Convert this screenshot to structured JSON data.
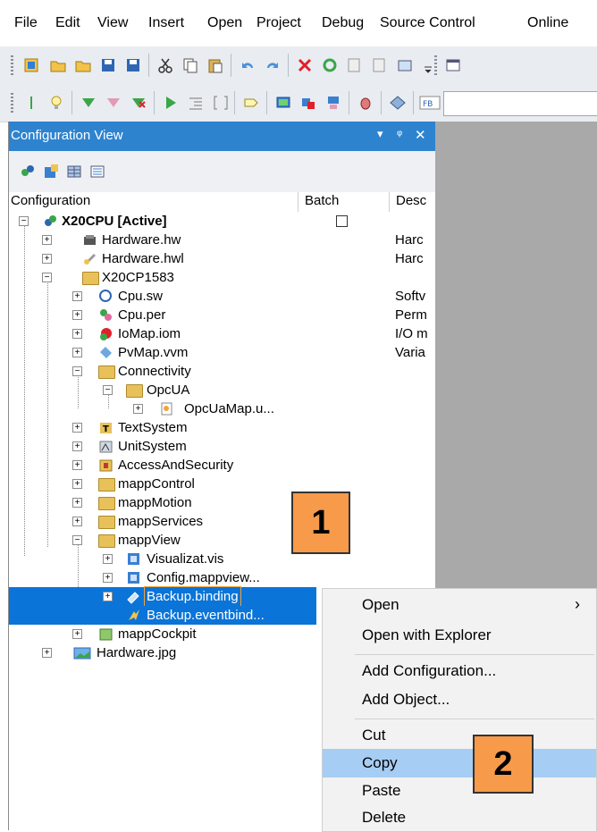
{
  "menu": [
    "File",
    "Edit",
    "View",
    "Insert",
    "Open",
    "Project",
    "Debug",
    "Source Control",
    "Online"
  ],
  "panel": {
    "title": "Configuration View",
    "title_icons": [
      "▾",
      "ᵠ",
      "✕"
    ],
    "columns": {
      "configuration": "Configuration",
      "batch": "Batch",
      "description": "Desc"
    }
  },
  "tree": {
    "root": "X20CPU [Active]",
    "hw": "Hardware.hw",
    "hw_desc": "Harc",
    "hwl": "Hardware.hwl",
    "hwl_desc": "Harc",
    "cpu_folder": "X20CP1583",
    "cpusw": "Cpu.sw",
    "cpusw_desc": "Softv",
    "cpuper": "Cpu.per",
    "cpuper_desc": "Perm",
    "iomap": "IoMap.iom",
    "iomap_desc": "I/O m",
    "pvmap": "PvMap.vvm",
    "pvmap_desc": "Varia",
    "connectivity": "Connectivity",
    "opcua": "OpcUA",
    "opcuamap": "OpcUaMap.u...",
    "textsystem": "TextSystem",
    "unitsystem": "UnitSystem",
    "access": "AccessAndSecurity",
    "mappcontrol": "mappControl",
    "mappmotion": "mappMotion",
    "mappservices": "mappServices",
    "mappview": "mappView",
    "vis": "Visualizat.vis",
    "configmv": "Config.mappview...",
    "binding": "Backup.binding",
    "eventbind": "Backup.eventbind...",
    "mappcockpit": "mappCockpit",
    "hwjpg": "Hardware.jpg"
  },
  "context_menu": {
    "open": "Open",
    "open_arrow": "›",
    "open_explorer": "Open with Explorer",
    "add_config": "Add Configuration...",
    "add_object": "Add Object...",
    "cut": "Cut",
    "copy": "Copy",
    "paste": "Paste",
    "delete": "Delete"
  },
  "callouts": {
    "one": "1",
    "two": "2"
  },
  "colors": {
    "title_bar": "#2e83cf",
    "selection": "#0a74d8",
    "menu_highlight": "#a6cdf3",
    "callout": "#f79a4a",
    "workspace": "#a9a9a9"
  }
}
